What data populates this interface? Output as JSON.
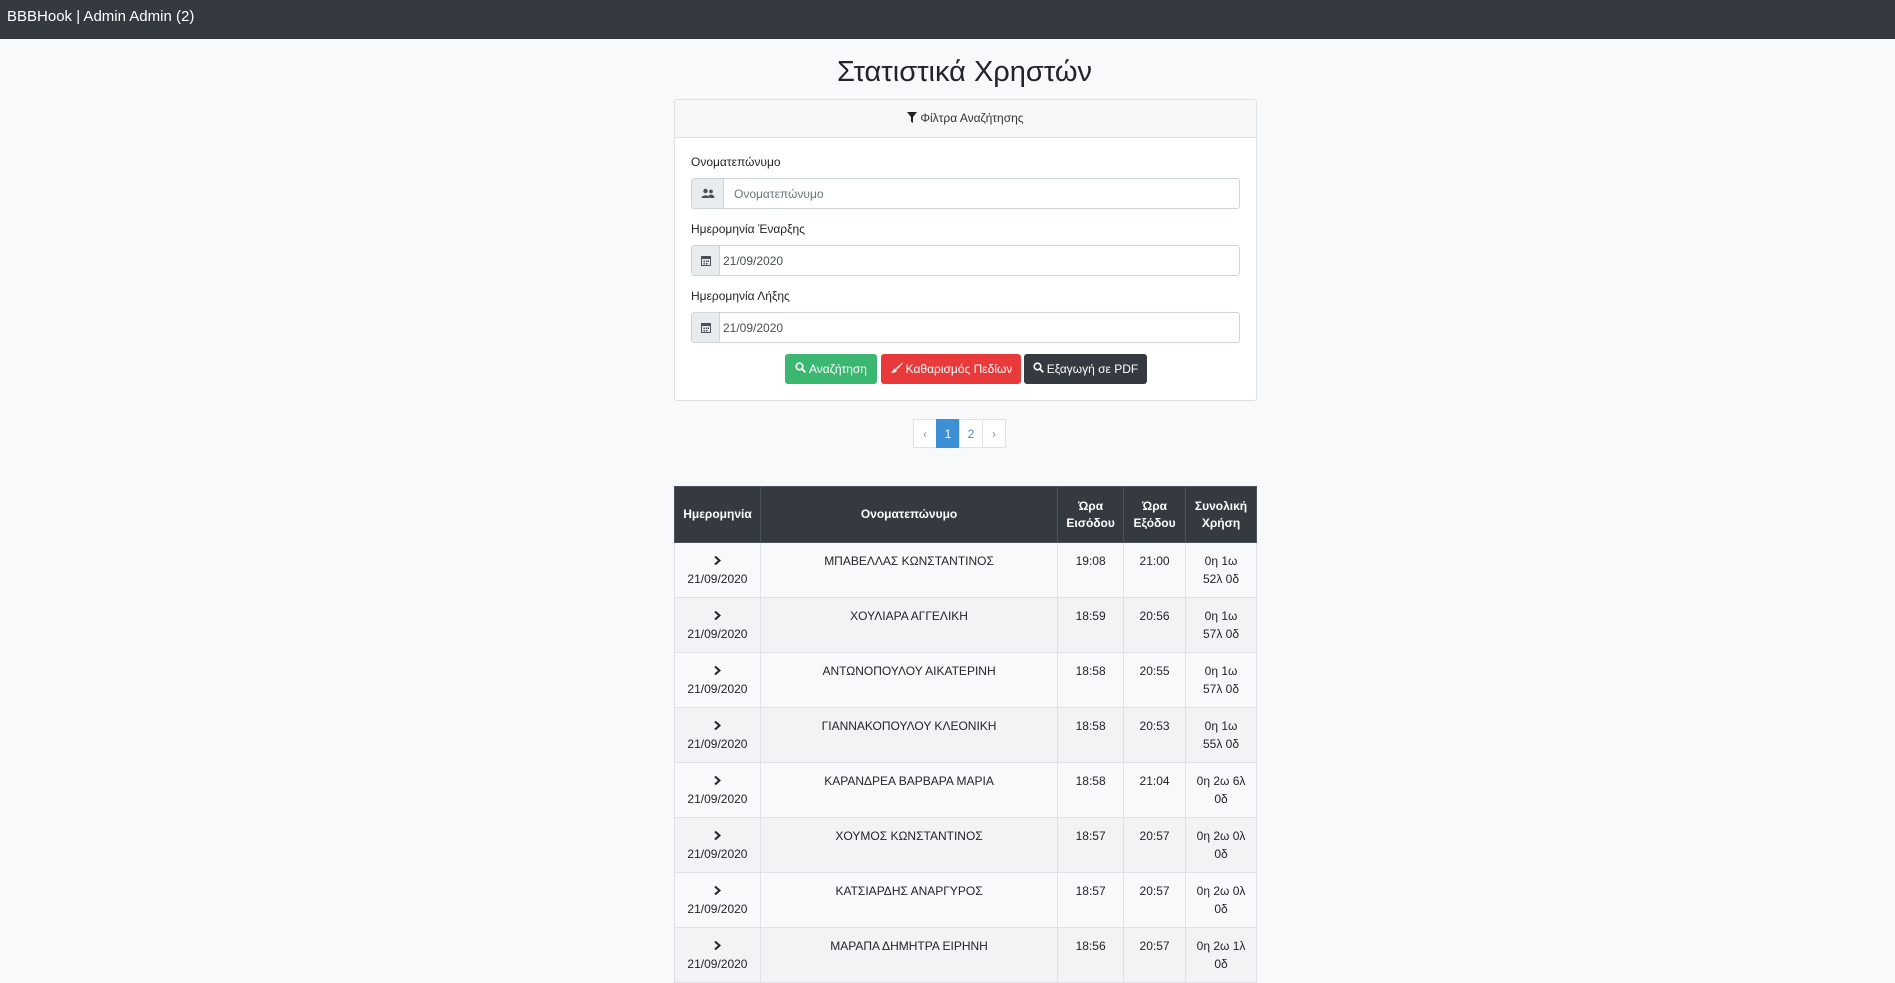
{
  "navbar": {
    "brand": "BBBHook | Admin Admin (2)"
  },
  "page": {
    "title": "Στατιστικά Χρηστών"
  },
  "filters": {
    "header": "Φίλτρα Αναζήτησης",
    "name_label": "Ονοματεπώνυμο",
    "name_placeholder": "Ονοματεπώνυμο",
    "start_label": "Ημερομηνία Έναρξης",
    "start_value": "21/09/2020",
    "end_label": "Ημερομηνία Λήξης",
    "end_value": "21/09/2020",
    "search_label": "Αναζήτηση",
    "clear_label": "Καθαρισμός Πεδίων",
    "pdf_label": "Εξαγωγή σε PDF"
  },
  "pagination": {
    "prev": "‹",
    "pages": [
      "1",
      "2"
    ],
    "next": "›",
    "active": "1"
  },
  "table": {
    "headers": {
      "date": "Ημερομηνία",
      "name": "Ονοματεπώνυμο",
      "entry": [
        "Ώρα",
        "Εισόδου"
      ],
      "exit": [
        "Ώρα",
        "Εξόδου"
      ],
      "total": [
        "Συνολική",
        "Χρήση"
      ]
    },
    "rows": [
      {
        "date": "21/09/2020",
        "name": "ΜΠΑΒΕΛΛΑΣ ΚΩΝΣΤΑΝΤΙΝΟΣ",
        "entry": "19:08",
        "exit": "21:00",
        "total": [
          "0η 1ω",
          "52λ 0δ"
        ]
      },
      {
        "date": "21/09/2020",
        "name": "ΧΟΥΛΙΑΡΑ ΑΓΓΕΛΙΚΗ",
        "entry": "18:59",
        "exit": "20:56",
        "total": [
          "0η 1ω",
          "57λ 0δ"
        ]
      },
      {
        "date": "21/09/2020",
        "name": "ΑΝΤΩΝΟΠΟΥΛΟΥ ΑΙΚΑΤΕΡΙΝΗ",
        "entry": "18:58",
        "exit": "20:55",
        "total": [
          "0η 1ω",
          "57λ 0δ"
        ]
      },
      {
        "date": "21/09/2020",
        "name": "ΓΙΑΝΝΑΚΟΠΟΥΛΟΥ ΚΛΕΟΝΙΚΗ",
        "entry": "18:58",
        "exit": "20:53",
        "total": [
          "0η 1ω",
          "55λ 0δ"
        ]
      },
      {
        "date": "21/09/2020",
        "name": "ΚΑΡΑΝΔΡΕΑ ΒΑΡΒΑΡΑ ΜΑΡΙΑ",
        "entry": "18:58",
        "exit": "21:04",
        "total": [
          "0η 2ω 6λ",
          "0δ"
        ]
      },
      {
        "date": "21/09/2020",
        "name": "ΧΟΥΜΟΣ ΚΩΝΣΤΑΝΤΙΝΟΣ",
        "entry": "18:57",
        "exit": "20:57",
        "total": [
          "0η 2ω 0λ",
          "0δ"
        ]
      },
      {
        "date": "21/09/2020",
        "name": "ΚΑΤΣΙΑΡΔΗΣ ΑΝΑΡΓΥΡΟΣ",
        "entry": "18:57",
        "exit": "20:57",
        "total": [
          "0η 2ω 0λ",
          "0δ"
        ]
      },
      {
        "date": "21/09/2020",
        "name": "ΜΑΡΑΠΑ ΔΗΜΗΤΡΑ ΕΙΡΗΝΗ",
        "entry": "18:56",
        "exit": "20:57",
        "total": [
          "0η 2ω 1λ",
          "0δ"
        ]
      }
    ]
  },
  "icons": {
    "filter": "filter-icon",
    "users": "users-icon",
    "calendar": "calendar-icon",
    "search": "search-icon",
    "brush": "brush-icon",
    "chevron": "chevron-right-icon"
  },
  "colors": {
    "navbar": "#343a40",
    "success": "#3cb772",
    "danger": "#e83a3a",
    "dark": "#343a40",
    "primary": "#3d8fd6"
  }
}
